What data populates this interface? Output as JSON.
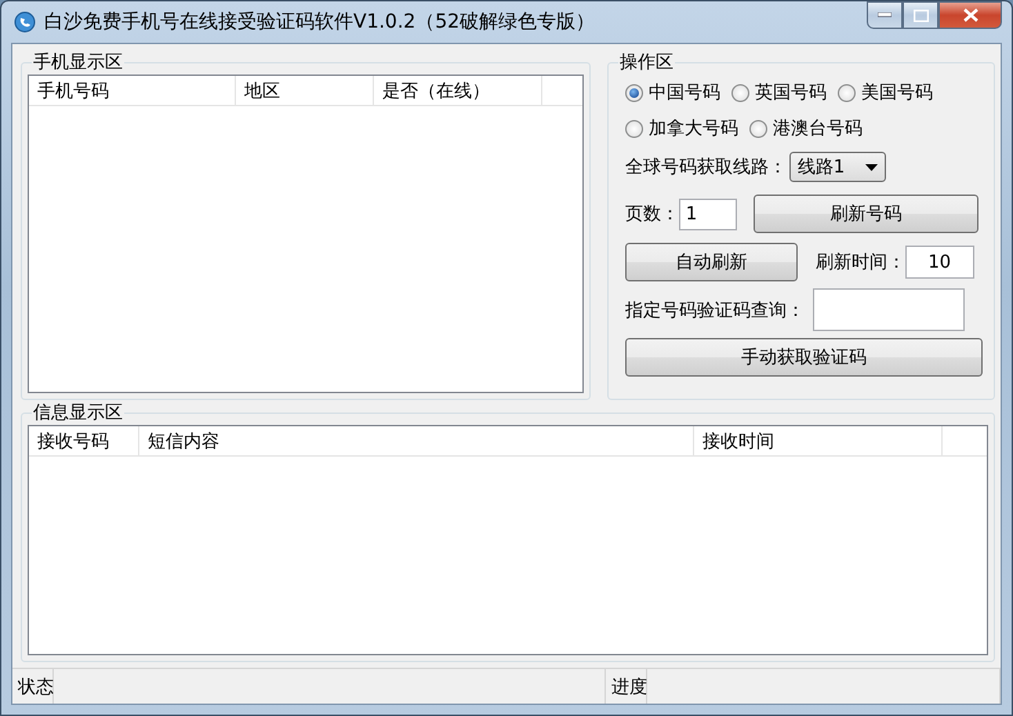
{
  "window": {
    "title": "白沙免费手机号在线接受验证码软件V1.0.2（52破解绿色专版）"
  },
  "phone_panel": {
    "title": "手机显示区",
    "columns": [
      "手机号码",
      "地区",
      "是否（在线）"
    ]
  },
  "operation_panel": {
    "title": "操作区",
    "regions": [
      {
        "label": "中国号码",
        "selected": true
      },
      {
        "label": "英国号码",
        "selected": false
      },
      {
        "label": "美国号码",
        "selected": false
      },
      {
        "label": "加拿大号码",
        "selected": false
      },
      {
        "label": "港澳台号码",
        "selected": false
      }
    ],
    "route": {
      "label": "全球号码获取线路：",
      "value": "线路1"
    },
    "page": {
      "label": "页数：",
      "value": "1"
    },
    "refresh_button": "刷新号码",
    "auto_refresh_button": "自动刷新",
    "refresh_interval": {
      "label": "刷新时间：",
      "value": "10"
    },
    "query": {
      "label": "指定号码验证码查询："
    },
    "manual_button": "手动获取验证码"
  },
  "message_panel": {
    "title": "信息显示区",
    "columns": [
      "接收号码",
      "短信内容",
      "接收时间"
    ]
  },
  "status_bar": [
    "状态",
    "进度"
  ]
}
